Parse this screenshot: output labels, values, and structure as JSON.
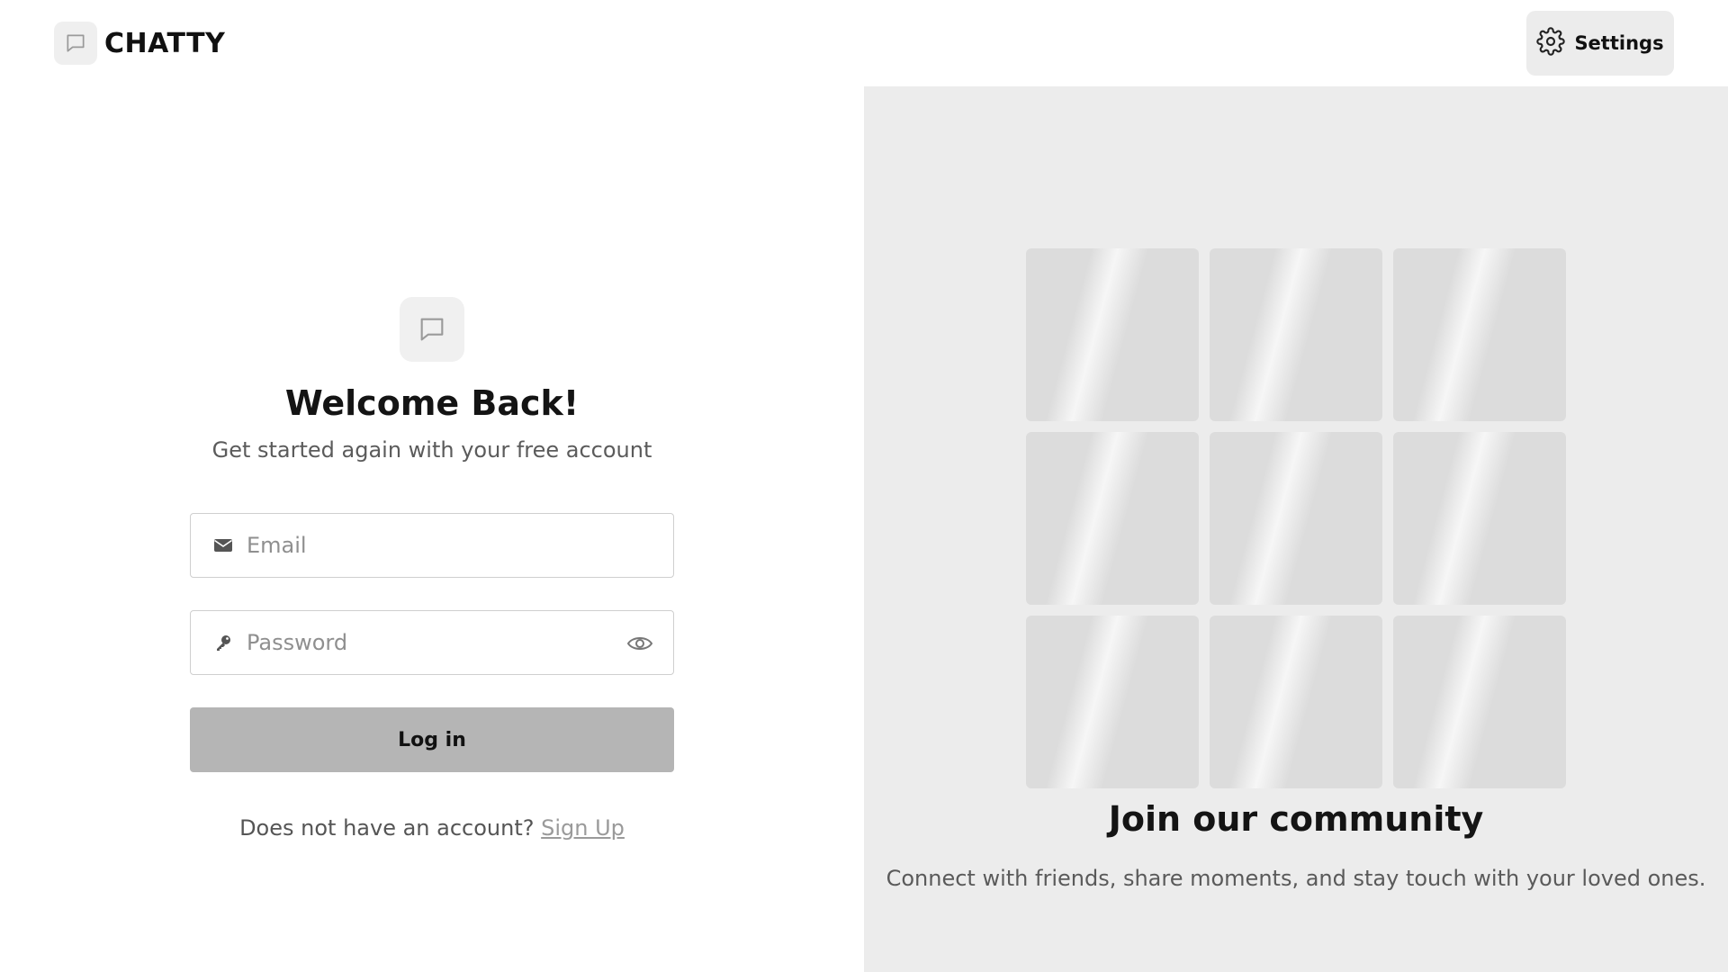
{
  "header": {
    "brand_name": "CHATTY",
    "brand_icon": "chat-bubble-icon",
    "settings_label": "Settings",
    "settings_icon": "gear-icon"
  },
  "login": {
    "icon": "chat-bubble-icon",
    "title": "Welcome Back!",
    "subtitle": "Get started again with your free account",
    "email_placeholder": "Email",
    "email_value": "",
    "email_icon": "envelope-icon",
    "password_placeholder": "Password",
    "password_value": "",
    "password_icon": "key-icon",
    "password_toggle_icon": "eye-icon",
    "login_label": "Log in",
    "signup_prompt": "Does not have an account?",
    "signup_link": "Sign Up"
  },
  "community": {
    "tile_count": 9,
    "title": "Join our community",
    "text": "Connect with friends, share moments, and stay touch with your loved ones."
  },
  "colors": {
    "page_bg": "#ffffff",
    "panel_bg": "#ececec",
    "button_bg": "#b5b5b5",
    "tile_bg": "#dcdcdc",
    "link": "#9a9a9a"
  }
}
